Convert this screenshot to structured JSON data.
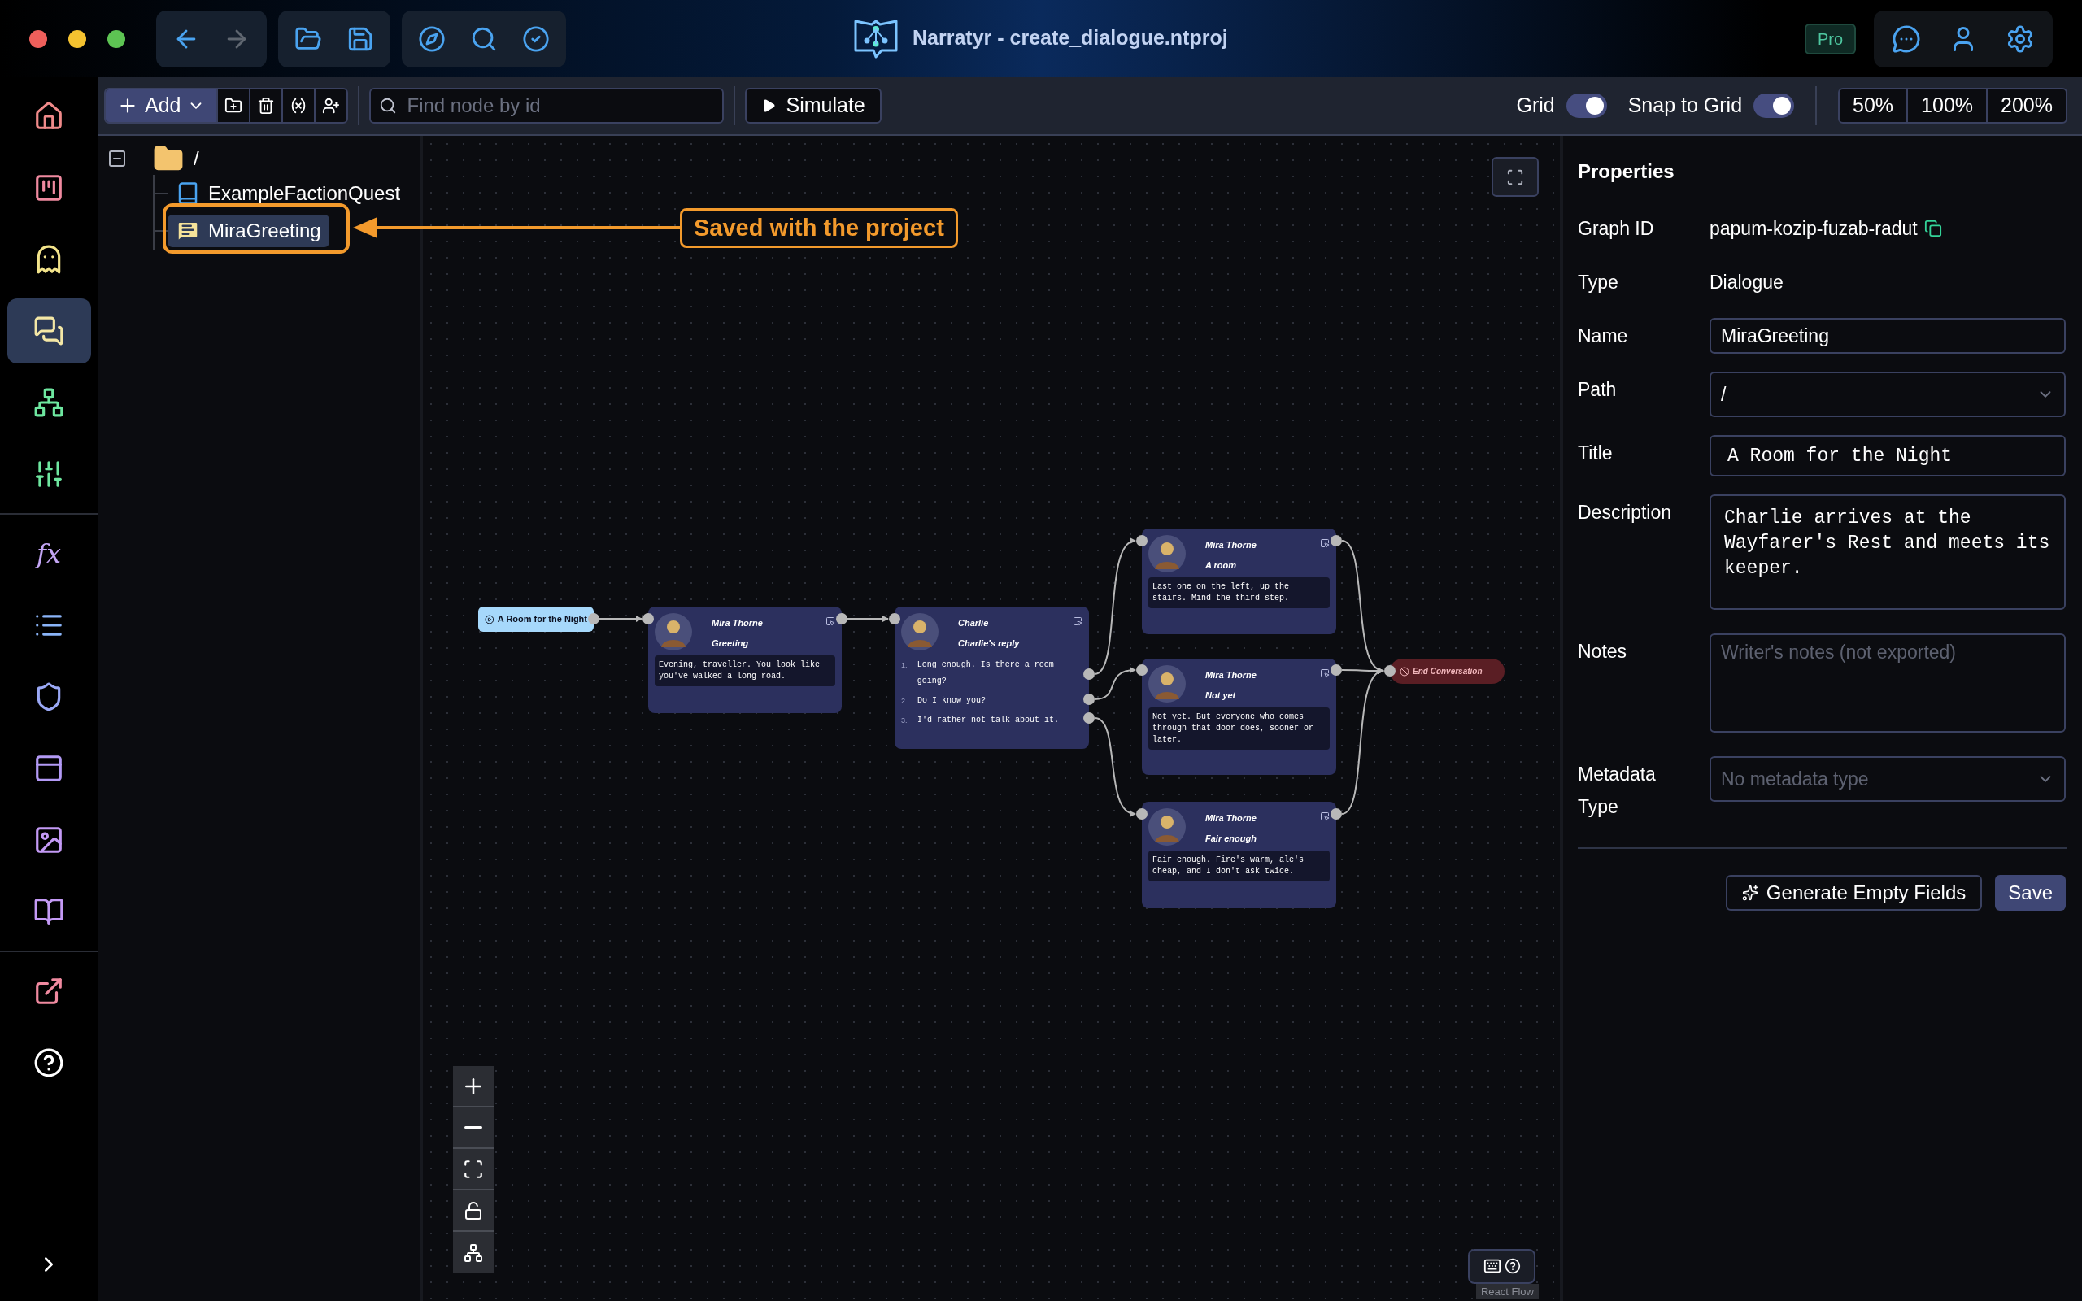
{
  "window": {
    "title": "Narratyr - create_dialogue.ntproj",
    "badge": "Pro"
  },
  "history": [
    {
      "disabled": false
    },
    {
      "disabled": true
    }
  ],
  "rail": [
    {
      "selected": false
    },
    {
      "selected": false
    },
    {
      "selected": false
    },
    {
      "selected": true
    },
    {
      "selected": false
    },
    {
      "selected": false
    },
    {
      "selected": false,
      "label": "fx"
    },
    {
      "selected": false
    },
    {
      "selected": false
    },
    {
      "selected": false
    },
    {
      "selected": false
    },
    {
      "selected": false
    },
    {
      "selected": false
    },
    {
      "selected": false
    }
  ],
  "toolbar": {
    "add_label": "Add",
    "search_placeholder": "Find node by id",
    "simulate_label": "Simulate",
    "toggles": [
      {
        "label": "Grid",
        "on": true
      },
      {
        "label": "Snap to Grid",
        "on": true
      }
    ],
    "zoom_levels": [
      "50%",
      "100%",
      "200%"
    ]
  },
  "tree": {
    "label": "/",
    "expanded": true,
    "children": [
      {
        "label": "ExampleFactionQuest",
        "kind": "quest",
        "selected": false
      },
      {
        "label": "MiraGreeting",
        "kind": "dialogue",
        "selected": true
      }
    ]
  },
  "annotation": {
    "text": "Saved with the project"
  },
  "canvas": {
    "nodes": [
      {
        "kind": "start",
        "label": "A Room for the Night"
      },
      {
        "kind": "line",
        "speaker": "Mira Thorne",
        "subtitle": "Greeting",
        "text": "Evening, traveller. You look like you've walked a long road."
      },
      {
        "kind": "choice",
        "speaker": "Charlie",
        "subtitle": "Charlie's reply",
        "choices": [
          {
            "number": "1.",
            "text": "Long enough. Is there a room going?"
          },
          {
            "number": "2.",
            "text": "Do I know you?"
          },
          {
            "number": "3.",
            "text": "I'd rather not talk about it."
          }
        ]
      },
      {
        "kind": "line",
        "speaker": "Mira Thorne",
        "subtitle": "A room",
        "text": "Last one on the left, up the stairs. Mind the third step."
      },
      {
        "kind": "line",
        "speaker": "Mira Thorne",
        "subtitle": "Not yet",
        "text": "Not yet. But everyone who comes through that door does, sooner or later."
      },
      {
        "kind": "line",
        "speaker": "Mira Thorne",
        "subtitle": "Fair enough",
        "text": "Fair enough. Fire's warm, ale's cheap, and I don't ask twice."
      },
      {
        "kind": "end",
        "label": "End Conversation"
      }
    ],
    "attribution": "React Flow"
  },
  "properties": {
    "heading": "Properties",
    "rows": [
      {
        "kind": "text",
        "label": "Graph ID",
        "value": "papum-kozip-fuzab-radut",
        "copyable": true
      },
      {
        "kind": "text",
        "label": "Type",
        "value": "Dialogue"
      },
      {
        "kind": "input",
        "label": "Name",
        "value": "MiraGreeting"
      },
      {
        "kind": "select",
        "label": "Path",
        "value": "/"
      },
      {
        "kind": "mono",
        "label": "Title",
        "value": "A Room for the Night"
      },
      {
        "kind": "textarea",
        "label": "Description",
        "value": "Charlie arrives at the Wayfarer's Rest and meets its keeper."
      },
      {
        "kind": "textarea",
        "label": "Notes",
        "placeholder": "Writer's notes (not exported)"
      },
      {
        "kind": "select",
        "label": "Metadata Type",
        "placeholder": "No metadata type"
      }
    ],
    "buttons": [
      {
        "kind": "generate",
        "label": "Generate Empty Fields"
      },
      {
        "kind": "primary",
        "label": "Save"
      }
    ]
  }
}
